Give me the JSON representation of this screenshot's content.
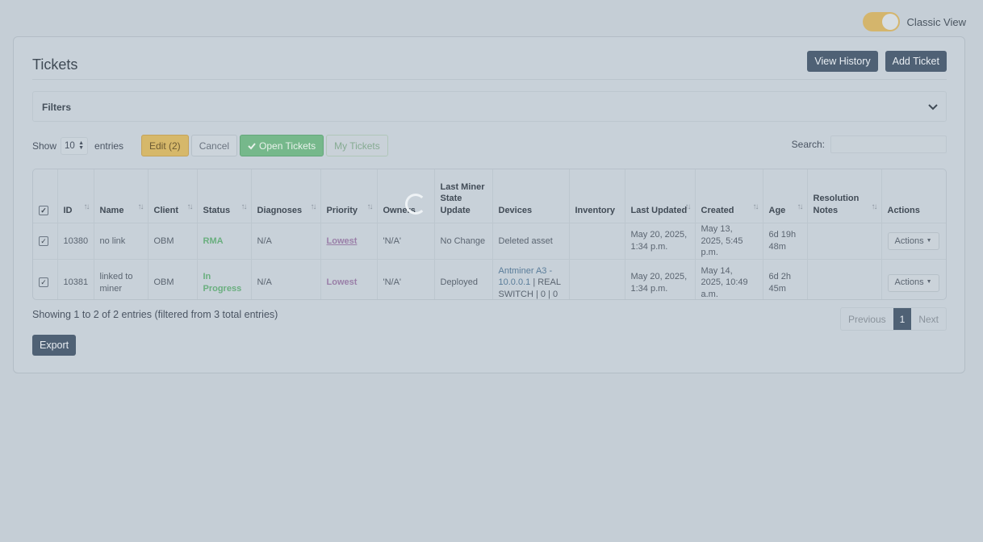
{
  "header": {
    "toggle_label": "Classic View"
  },
  "card": {
    "title": "Tickets",
    "view_history": "View History",
    "add_ticket": "Add Ticket",
    "filters_label": "Filters"
  },
  "toolbar": {
    "show_label": "Show",
    "entries_value": "10",
    "entries_label": "entries",
    "edit_label": "Edit (2)",
    "cancel_label": "Cancel",
    "open_tickets_label": "Open Tickets",
    "my_tickets_label": "My Tickets",
    "search_label": "Search:"
  },
  "table": {
    "headers": [
      "ID",
      "Name",
      "Client",
      "Status",
      "Diagnoses",
      "Priority",
      "Owners",
      "Last Miner State Update",
      "Devices",
      "Inventory",
      "Last Updated",
      "Created",
      "Age",
      "Resolution Notes",
      "Actions"
    ],
    "rows": [
      {
        "id": "10380",
        "name": "no link",
        "client": "OBM",
        "status": "RMA",
        "diagnoses": "N/A",
        "priority": "Lowest",
        "owners": "'N/A'",
        "miner_state": "No Change",
        "devices": "Deleted asset",
        "devices_link": "",
        "inventory": "",
        "last_updated": "May 20, 2025, 1:34 p.m.",
        "created": "May 13, 2025, 5:45 p.m.",
        "age": "6d 19h 48m",
        "resolution_notes": "",
        "actions": "Actions"
      },
      {
        "id": "10381",
        "name": "linked to miner",
        "client": "OBM",
        "status": "In Progress",
        "diagnoses": "N/A",
        "priority": "Lowest",
        "owners": "'N/A'",
        "miner_state": "Deployed",
        "devices_link": "Antminer A3 - 10.0.0.1",
        "devices": " | REAL SWITCH | 0 | 0",
        "inventory": "",
        "last_updated": "May 20, 2025, 1:34 p.m.",
        "created": "May 14, 2025, 10:49 a.m.",
        "age": "6d 2h 45m",
        "resolution_notes": "",
        "actions": "Actions"
      }
    ]
  },
  "footer": {
    "info": "Showing 1 to 2 of 2 entries (filtered from 3 total entries)",
    "previous": "Previous",
    "page": "1",
    "next": "Next",
    "export": "Export"
  },
  "colors": {
    "accent_dark": "#4f6175",
    "edit_yellow": "#d6b86a",
    "open_green": "#76b88b",
    "toggle_on": "#d4b56c"
  },
  "icons": [
    "chevron-down-icon",
    "check-icon",
    "checkbox-icon",
    "sort-icon",
    "caret-down-icon",
    "loading-spinner-icon"
  ]
}
